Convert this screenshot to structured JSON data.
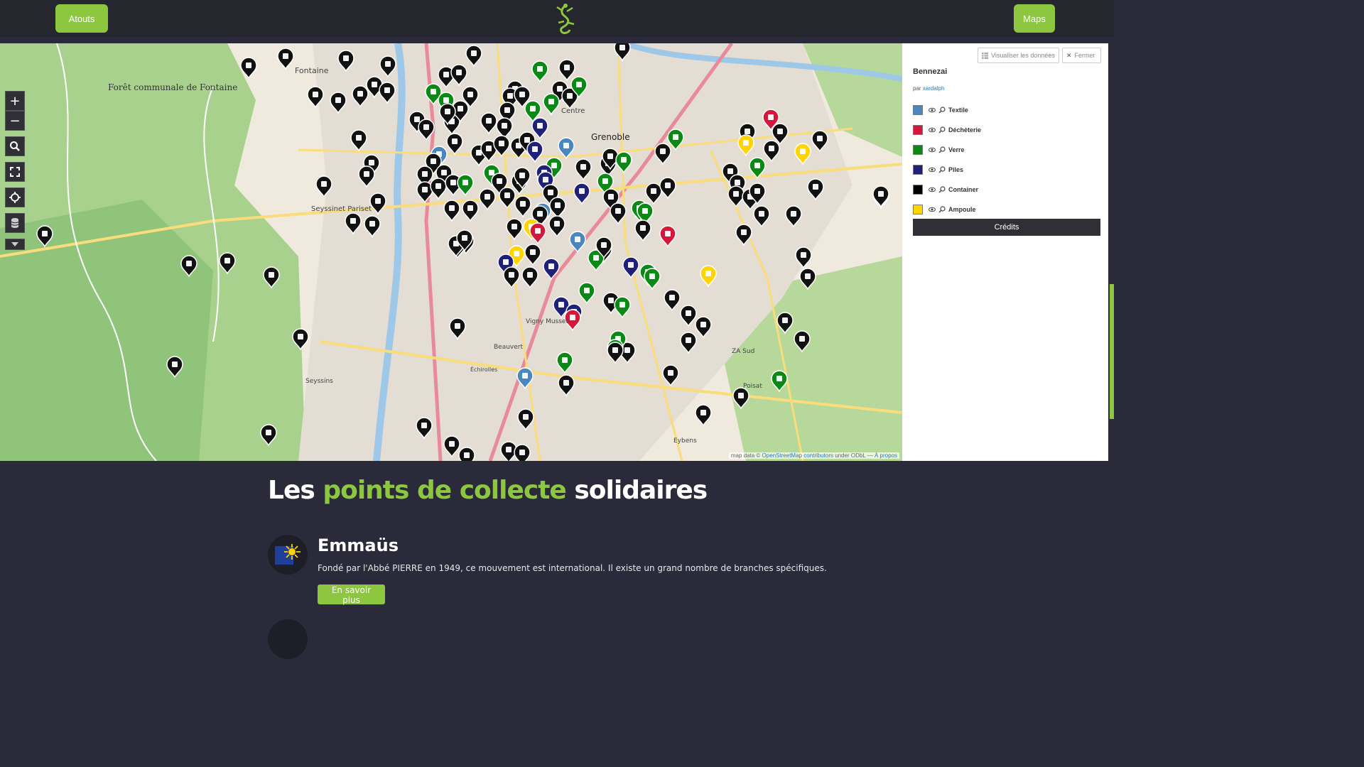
{
  "header": {
    "left_button": "Atouts",
    "right_button": "Maps",
    "logo_icon": "gecko-logo-icon",
    "accent_color": "#8dc63f"
  },
  "map": {
    "controls": {
      "zoom_in": "+",
      "zoom_out": "−",
      "search_icon": "search-icon",
      "fullscreen_icon": "fullscreen-icon",
      "locate_icon": "locate-icon",
      "layers_icon": "layers-icon",
      "more_icon": "caret-down-icon"
    },
    "place_labels": [
      "Forêt communale de Fontaine",
      "Fontaine",
      "Grenoble",
      "Seyssinet Pariset",
      "Seyssins",
      "Eybens",
      "Poisat",
      "Vigny Musset",
      "Beauvert",
      "Centre",
      "ZA Sud",
      "Échirolles"
    ],
    "attribution": {
      "prefix": "map data © ",
      "osm": "OpenStreetMap contributors",
      "middle": " under ODbL — ",
      "about": "À propos"
    }
  },
  "panel": {
    "view_data": "Visualiser les données",
    "close": "Fermer",
    "title": "Bennezai",
    "by_prefix": "par ",
    "author": "xardalph",
    "layers": [
      {
        "label": "Textile",
        "color": "#4a86c0"
      },
      {
        "label": "Déchèterie",
        "color": "#d4173a"
      },
      {
        "label": "Verre",
        "color": "#0a8a14"
      },
      {
        "label": "Piles",
        "color": "#1f2078"
      },
      {
        "label": "Container",
        "color": "#000000"
      },
      {
        "label": "Ampoule",
        "color": "#ffd400"
      }
    ],
    "credits": "Crédits"
  },
  "section": {
    "title_start": "Les ",
    "title_accent": "points de collecte",
    "title_end": " solidaires"
  },
  "organizations": [
    {
      "name": "Emmaüs",
      "description": "Fondé par l'Abbé PIERRE en 1949, ce mouvement est international. Il existe un grand nombre de branches spécifiques.",
      "button": "En savoir plus"
    }
  ]
}
